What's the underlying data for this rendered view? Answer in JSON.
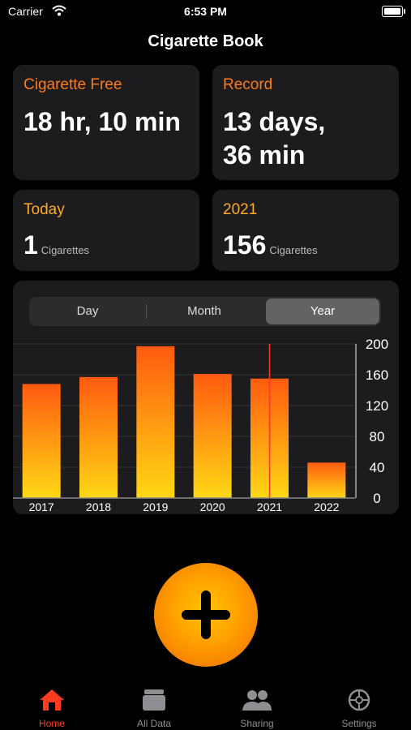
{
  "status_bar": {
    "carrier": "Carrier",
    "time": "6:53 PM"
  },
  "nav": {
    "title": "Cigarette Book"
  },
  "cards": {
    "cigarette_free": {
      "label": "Cigarette Free",
      "value": "18 hr, 10 min"
    },
    "record": {
      "label": "Record",
      "value_line1": "13 days,",
      "value_line2": "36 min"
    },
    "today": {
      "label": "Today",
      "value": "1",
      "unit": "Cigarettes"
    },
    "year": {
      "label": "2021",
      "value": "156",
      "unit": "Cigarettes"
    }
  },
  "segmented": {
    "options": [
      "Day",
      "Month",
      "Year"
    ],
    "selected": "Year"
  },
  "chart_data": {
    "type": "bar",
    "categories": [
      "2017",
      "2018",
      "2019",
      "2020",
      "2021",
      "2022"
    ],
    "values": [
      148,
      157,
      197,
      161,
      155,
      46
    ],
    "ylim": [
      0,
      200
    ],
    "yticks": [
      "200",
      "160",
      "120",
      "80",
      "40",
      "0"
    ],
    "highlighted": "2021",
    "bar_gradient": [
      "#ff5a10",
      "#ffd814"
    ]
  },
  "tabs": [
    {
      "label": "Home",
      "icon": "home-icon",
      "active": true
    },
    {
      "label": "All Data",
      "icon": "all-data-icon",
      "active": false
    },
    {
      "label": "Sharing",
      "icon": "sharing-icon",
      "active": false
    },
    {
      "label": "Settings",
      "icon": "settings-icon",
      "active": false
    }
  ],
  "colors": {
    "accent": "#ff3b1f",
    "card": "#1c1c1e",
    "orange": "#ff7a1a",
    "yellow": "#ffaa22"
  }
}
